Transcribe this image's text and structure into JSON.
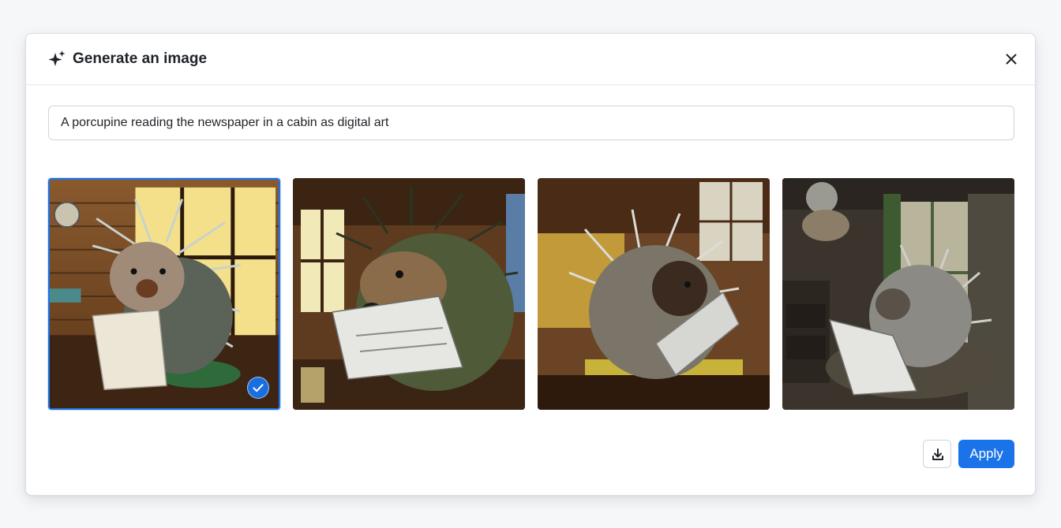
{
  "dialog": {
    "title": "Generate an image",
    "title_icon": "sparkle-icon",
    "close_icon": "close-icon"
  },
  "prompt": {
    "value": "A porcupine reading the newspaper in a cabin as digital art"
  },
  "images": [
    {
      "name": "generated-image-1",
      "selected": true,
      "description_icon": "porcupine-image"
    },
    {
      "name": "generated-image-2",
      "selected": false,
      "description_icon": "porcupine-image"
    },
    {
      "name": "generated-image-3",
      "selected": false,
      "description_icon": "porcupine-image"
    },
    {
      "name": "generated-image-4",
      "selected": false,
      "description_icon": "porcupine-image"
    }
  ],
  "actions": {
    "download_icon": "download-icon",
    "apply_label": "Apply"
  },
  "colors": {
    "accent": "#1a73e8",
    "text": "#1f2328",
    "border": "#cfd4da"
  }
}
